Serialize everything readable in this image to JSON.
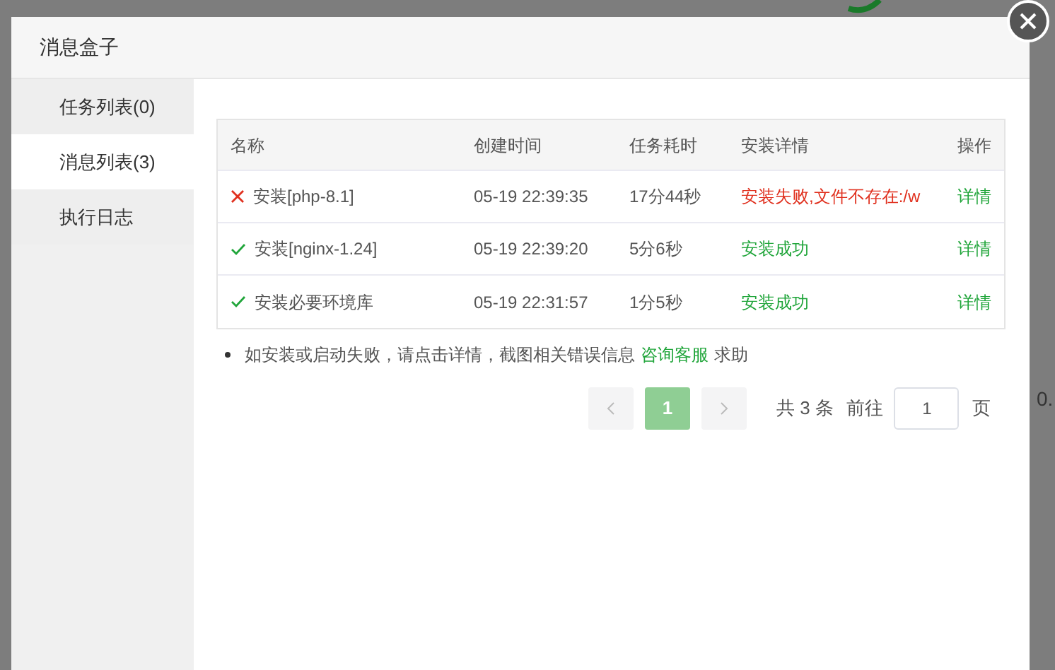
{
  "background": {
    "right_fragment": "0."
  },
  "dialog": {
    "title": "消息盒子"
  },
  "sidebar": {
    "items": [
      {
        "label": "任务列表(0)",
        "selected": false
      },
      {
        "label": "消息列表(3)",
        "selected": true
      },
      {
        "label": "执行日志",
        "selected": false
      }
    ]
  },
  "table": {
    "columns": [
      "名称",
      "创建时间",
      "任务耗时",
      "安装详情",
      "操作"
    ],
    "rows": [
      {
        "kind": "failed",
        "name": "安装[php-8.1]",
        "created": "05-19 22:39:35",
        "duration": "17分44秒",
        "detail": "安装失败,文件不存在:/w",
        "action": "详情"
      },
      {
        "kind": "success",
        "name": "安装[nginx-1.24]",
        "created": "05-19 22:39:20",
        "duration": "5分6秒",
        "detail": "安装成功",
        "action": "详情"
      },
      {
        "kind": "success",
        "name": "安装必要环境库",
        "created": "05-19 22:31:57",
        "duration": "1分5秒",
        "detail": "安装成功",
        "action": "详情"
      }
    ]
  },
  "note": {
    "text": "如安装或启动失败，请点击详情，截图相关错误信息",
    "link": "咨询客服",
    "suffix": "求助"
  },
  "pagination": {
    "pages": [
      {
        "label": "1",
        "selected": true
      }
    ],
    "total": "共 3 条",
    "goto_label": "前往",
    "goto_value": "1",
    "page_unit": "页"
  }
}
